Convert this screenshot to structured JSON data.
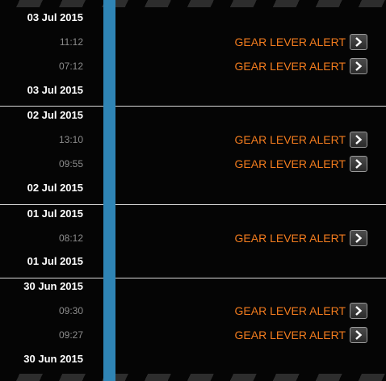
{
  "groups": [
    {
      "date_top": "03 Jul 2015",
      "events": [
        {
          "time": "11:12",
          "label": "GEAR LEVER ALERT",
          "icon": "chevron-right-icon"
        },
        {
          "time": "07:12",
          "label": "GEAR LEVER ALERT",
          "icon": "chevron-right-icon"
        }
      ],
      "date_bottom": "03 Jul 2015"
    },
    {
      "date_top": "02 Jul 2015",
      "events": [
        {
          "time": "13:10",
          "label": "GEAR LEVER ALERT",
          "icon": "chevron-right-icon"
        },
        {
          "time": "09:55",
          "label": "GEAR LEVER ALERT",
          "icon": "chevron-right-icon"
        }
      ],
      "date_bottom": "02 Jul 2015"
    },
    {
      "date_top": "01 Jul 2015",
      "events": [
        {
          "time": "08:12",
          "label": "GEAR LEVER ALERT",
          "icon": "chevron-right-icon"
        }
      ],
      "date_bottom": "01 Jul 2015"
    },
    {
      "date_top": "30 Jun 2015",
      "events": [
        {
          "time": "09:30",
          "label": "GEAR LEVER ALERT",
          "icon": "chevron-right-icon"
        },
        {
          "time": "09:27",
          "label": "GEAR LEVER ALERT",
          "icon": "chevron-right-icon"
        }
      ],
      "date_bottom": "30 Jun 2015"
    }
  ],
  "colors": {
    "background": "#050505",
    "timeline_rail": "#2f84b5",
    "alert_text": "#f27c1e",
    "date_text": "#ffffff",
    "time_text": "#8c8c8c",
    "divider": "#d8d8d8"
  }
}
